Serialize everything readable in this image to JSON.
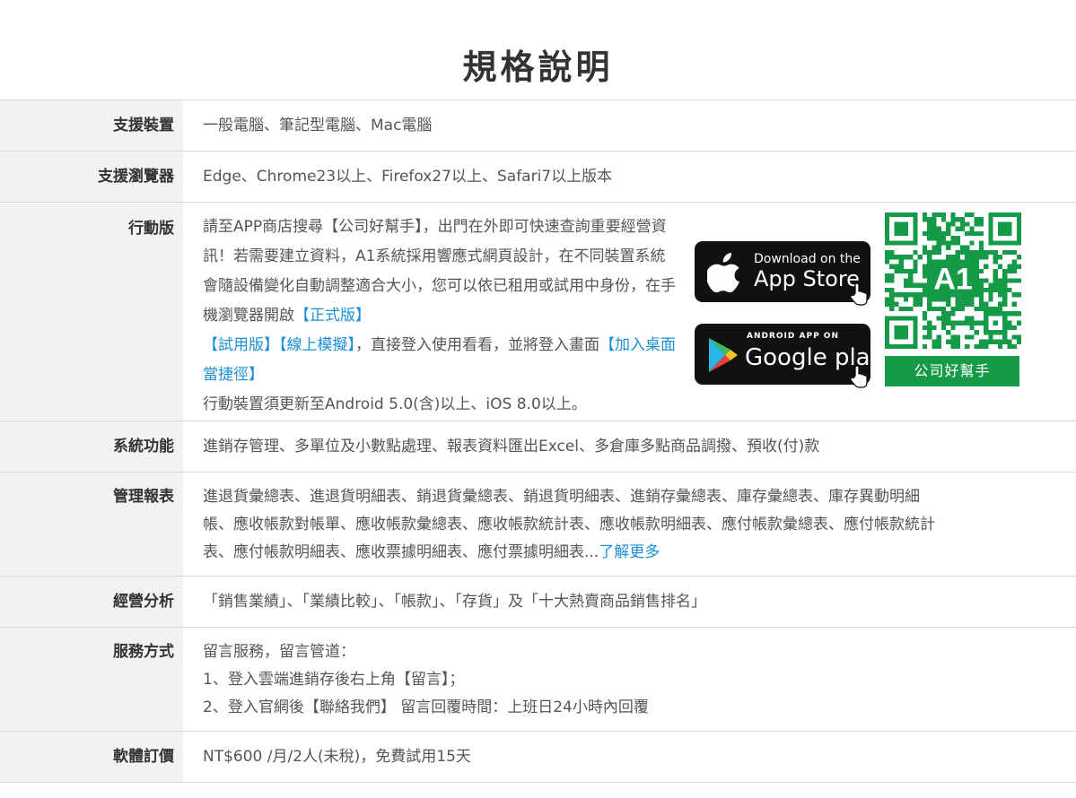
{
  "page_title": "規格說明",
  "specs": {
    "devices": {
      "label": "支援裝置",
      "value": "一般電腦、筆記型電腦、Mac電腦"
    },
    "browsers": {
      "label": "支援瀏覽器",
      "value": "Edge、Chrome23以上、Firefox27以上、Safari7以上版本"
    },
    "mobile": {
      "label": "行動版",
      "text1": "請至APP商店搜尋【公司好幫手】，出門在外即可快速查詢重要經營資訊！若需要建立資料，A1系統採用響應式網頁設計，在不同裝置系統會隨設備變化自動調整適合大小，您可以依已租用或試用中身份，在手機瀏覽器開啟",
      "link_official": "【正式版】",
      "link_trial": "【試用版】",
      "link_demo": "【線上模擬】",
      "text2": "，直接登入使用看看，並將登入畫面",
      "link_shortcut": "【加入桌面當捷徑】",
      "note": "行動裝置須更新至Android 5.0(含)以上、iOS 8.0以上。",
      "app_store": {
        "small": "Download on the",
        "big": "App Store"
      },
      "google_play": {
        "small": "ANDROID APP ON",
        "big": "Google play"
      },
      "qr_caption": "公司好幫手",
      "qr_logo_text": "A1"
    },
    "functions": {
      "label": "系統功能",
      "value": "進銷存管理、多單位及小數點處理、報表資料匯出Excel、多倉庫多點商品調撥、預收(付)款"
    },
    "reports": {
      "label": "管理報表",
      "line1": "進退貨彙總表、進退貨明細表、銷退貨彙總表、銷退貨明細表、進銷存彙總表、庫存彙總表、庫存異動明細",
      "line2": "帳、應收帳款對帳單、應收帳款彙總表、應收帳款統計表、應收帳款明細表、應付帳款彙總表、應付帳款統計",
      "line3": "表、應付帳款明細表、應收票據明細表、應付票據明細表...",
      "more_link": "了解更多"
    },
    "analysis": {
      "label": "經營分析",
      "value": "「銷售業績」、「業績比較」、「帳款」、「存貨」及「十大熱賣商品銷售排名」"
    },
    "service": {
      "label": "服務方式",
      "line1": "留言服務，留言管道：",
      "line2": "1、登入雲端進銷存後右上角【留言】；",
      "line3": "2、登入官網後【聯絡我們】 留言回覆時間：上班日24小時內回覆"
    },
    "pricing": {
      "label": "軟體訂價",
      "value": "NT$600 /月/2人(未稅)，免費試用15天"
    }
  },
  "colors": {
    "link": "#1a8fd6",
    "qr_green": "#159a48",
    "label_bg": "#f2f2f2",
    "border": "#d9d9d9"
  }
}
